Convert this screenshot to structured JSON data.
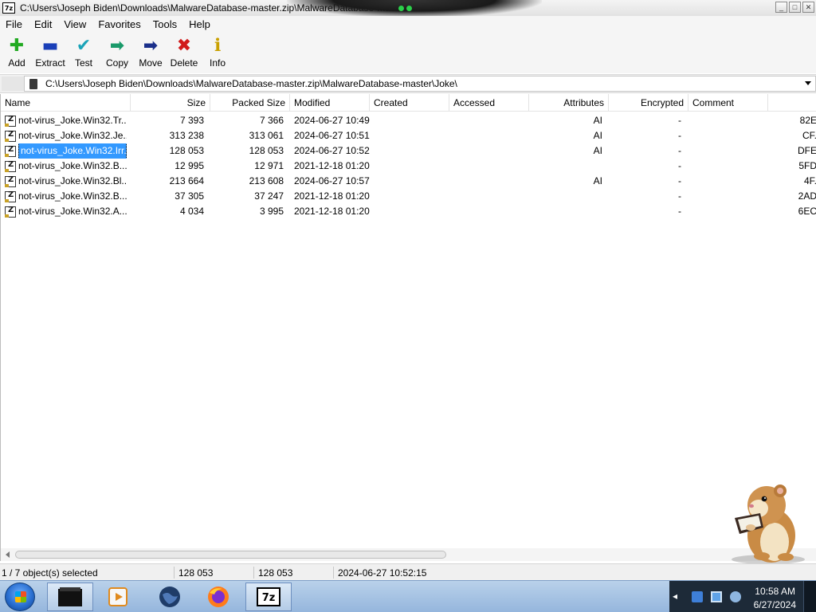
{
  "window": {
    "title": "C:\\Users\\Joseph Biden\\Downloads\\MalwareDatabase-master.zip\\MalwareDatabase-master\\Joke\\",
    "app_icon_label": "7z",
    "min_label": "_",
    "max_label": "□",
    "close_label": "✕"
  },
  "menu": [
    "File",
    "Edit",
    "View",
    "Favorites",
    "Tools",
    "Help"
  ],
  "toolbar": [
    {
      "label": "Add",
      "icon": "add-icon",
      "glyph": "✚",
      "color": "#22aa22"
    },
    {
      "label": "Extract",
      "icon": "extract-icon",
      "glyph": "▬",
      "color": "#1a3fb8"
    },
    {
      "label": "Test",
      "icon": "test-icon",
      "glyph": "✔",
      "color": "#1aa3b8"
    },
    {
      "label": "Copy",
      "icon": "copy-icon",
      "glyph": "➡",
      "color": "#1a9a6a"
    },
    {
      "label": "Move",
      "icon": "move-icon",
      "glyph": "➡",
      "color": "#1a2f8a"
    },
    {
      "label": "Delete",
      "icon": "delete-icon",
      "glyph": "✖",
      "color": "#d11b1b"
    },
    {
      "label": "Info",
      "icon": "info-icon",
      "glyph": "ℹ",
      "color": "#c9a000"
    }
  ],
  "address": {
    "path": "C:\\Users\\Joseph Biden\\Downloads\\MalwareDatabase-master.zip\\MalwareDatabase-master\\Joke\\"
  },
  "columns": [
    "Name",
    "Size",
    "Packed Size",
    "Modified",
    "Created",
    "Accessed",
    "Attributes",
    "Encrypted",
    "Comment",
    ""
  ],
  "files": [
    {
      "name": "not-virus_Joke.Win32.Tr...",
      "size": "7 393",
      "packed": "7 366",
      "modified": "2024-06-27 10:49",
      "attributes": "AI",
      "encrypted": "-",
      "crc": "82E",
      "selected": false
    },
    {
      "name": "not-virus_Joke.Win32.Je...",
      "size": "313 238",
      "packed": "313 061",
      "modified": "2024-06-27 10:51",
      "attributes": "AI",
      "encrypted": "-",
      "crc": "CF.",
      "selected": false
    },
    {
      "name": "not-virus_Joke.Win32.Irr...",
      "size": "128 053",
      "packed": "128 053",
      "modified": "2024-06-27 10:52",
      "attributes": "AI",
      "encrypted": "-",
      "crc": "DFE",
      "selected": true
    },
    {
      "name": "not-virus_Joke.Win32.B...",
      "size": "12 995",
      "packed": "12 971",
      "modified": "2021-12-18 01:20",
      "attributes": "",
      "encrypted": "-",
      "crc": "5FD",
      "selected": false
    },
    {
      "name": "not-virus_Joke.Win32.Bl...",
      "size": "213 664",
      "packed": "213 608",
      "modified": "2024-06-27 10:57",
      "attributes": "AI",
      "encrypted": "-",
      "crc": "4F.",
      "selected": false
    },
    {
      "name": "not-virus_Joke.Win32.B...",
      "size": "37 305",
      "packed": "37 247",
      "modified": "2021-12-18 01:20",
      "attributes": "",
      "encrypted": "-",
      "crc": "2AD",
      "selected": false
    },
    {
      "name": "not-virus_Joke.Win32.A...",
      "size": "4 034",
      "packed": "3 995",
      "modified": "2021-12-18 01:20",
      "attributes": "",
      "encrypted": "-",
      "crc": "6EC",
      "selected": false
    }
  ],
  "status": {
    "selection": "1 / 7 object(s) selected",
    "size": "128 053",
    "packed": "128 053",
    "modified": "2024-06-27 10:52:15"
  },
  "taskbar": {
    "items": [
      {
        "name": "taskbar-item-terminal",
        "icon": "terminal-icon",
        "active": true
      },
      {
        "name": "taskbar-item-media-player",
        "icon": "media-player-icon",
        "active": false
      },
      {
        "name": "taskbar-item-globe",
        "icon": "globe-icon",
        "active": false
      },
      {
        "name": "taskbar-item-firefox",
        "icon": "firefox-icon",
        "active": false
      },
      {
        "name": "taskbar-item-7zip",
        "icon": "7zip-icon",
        "active": true
      }
    ],
    "tray_arrow": "◂",
    "time": "10:58 AM",
    "date": "6/27/2024"
  }
}
